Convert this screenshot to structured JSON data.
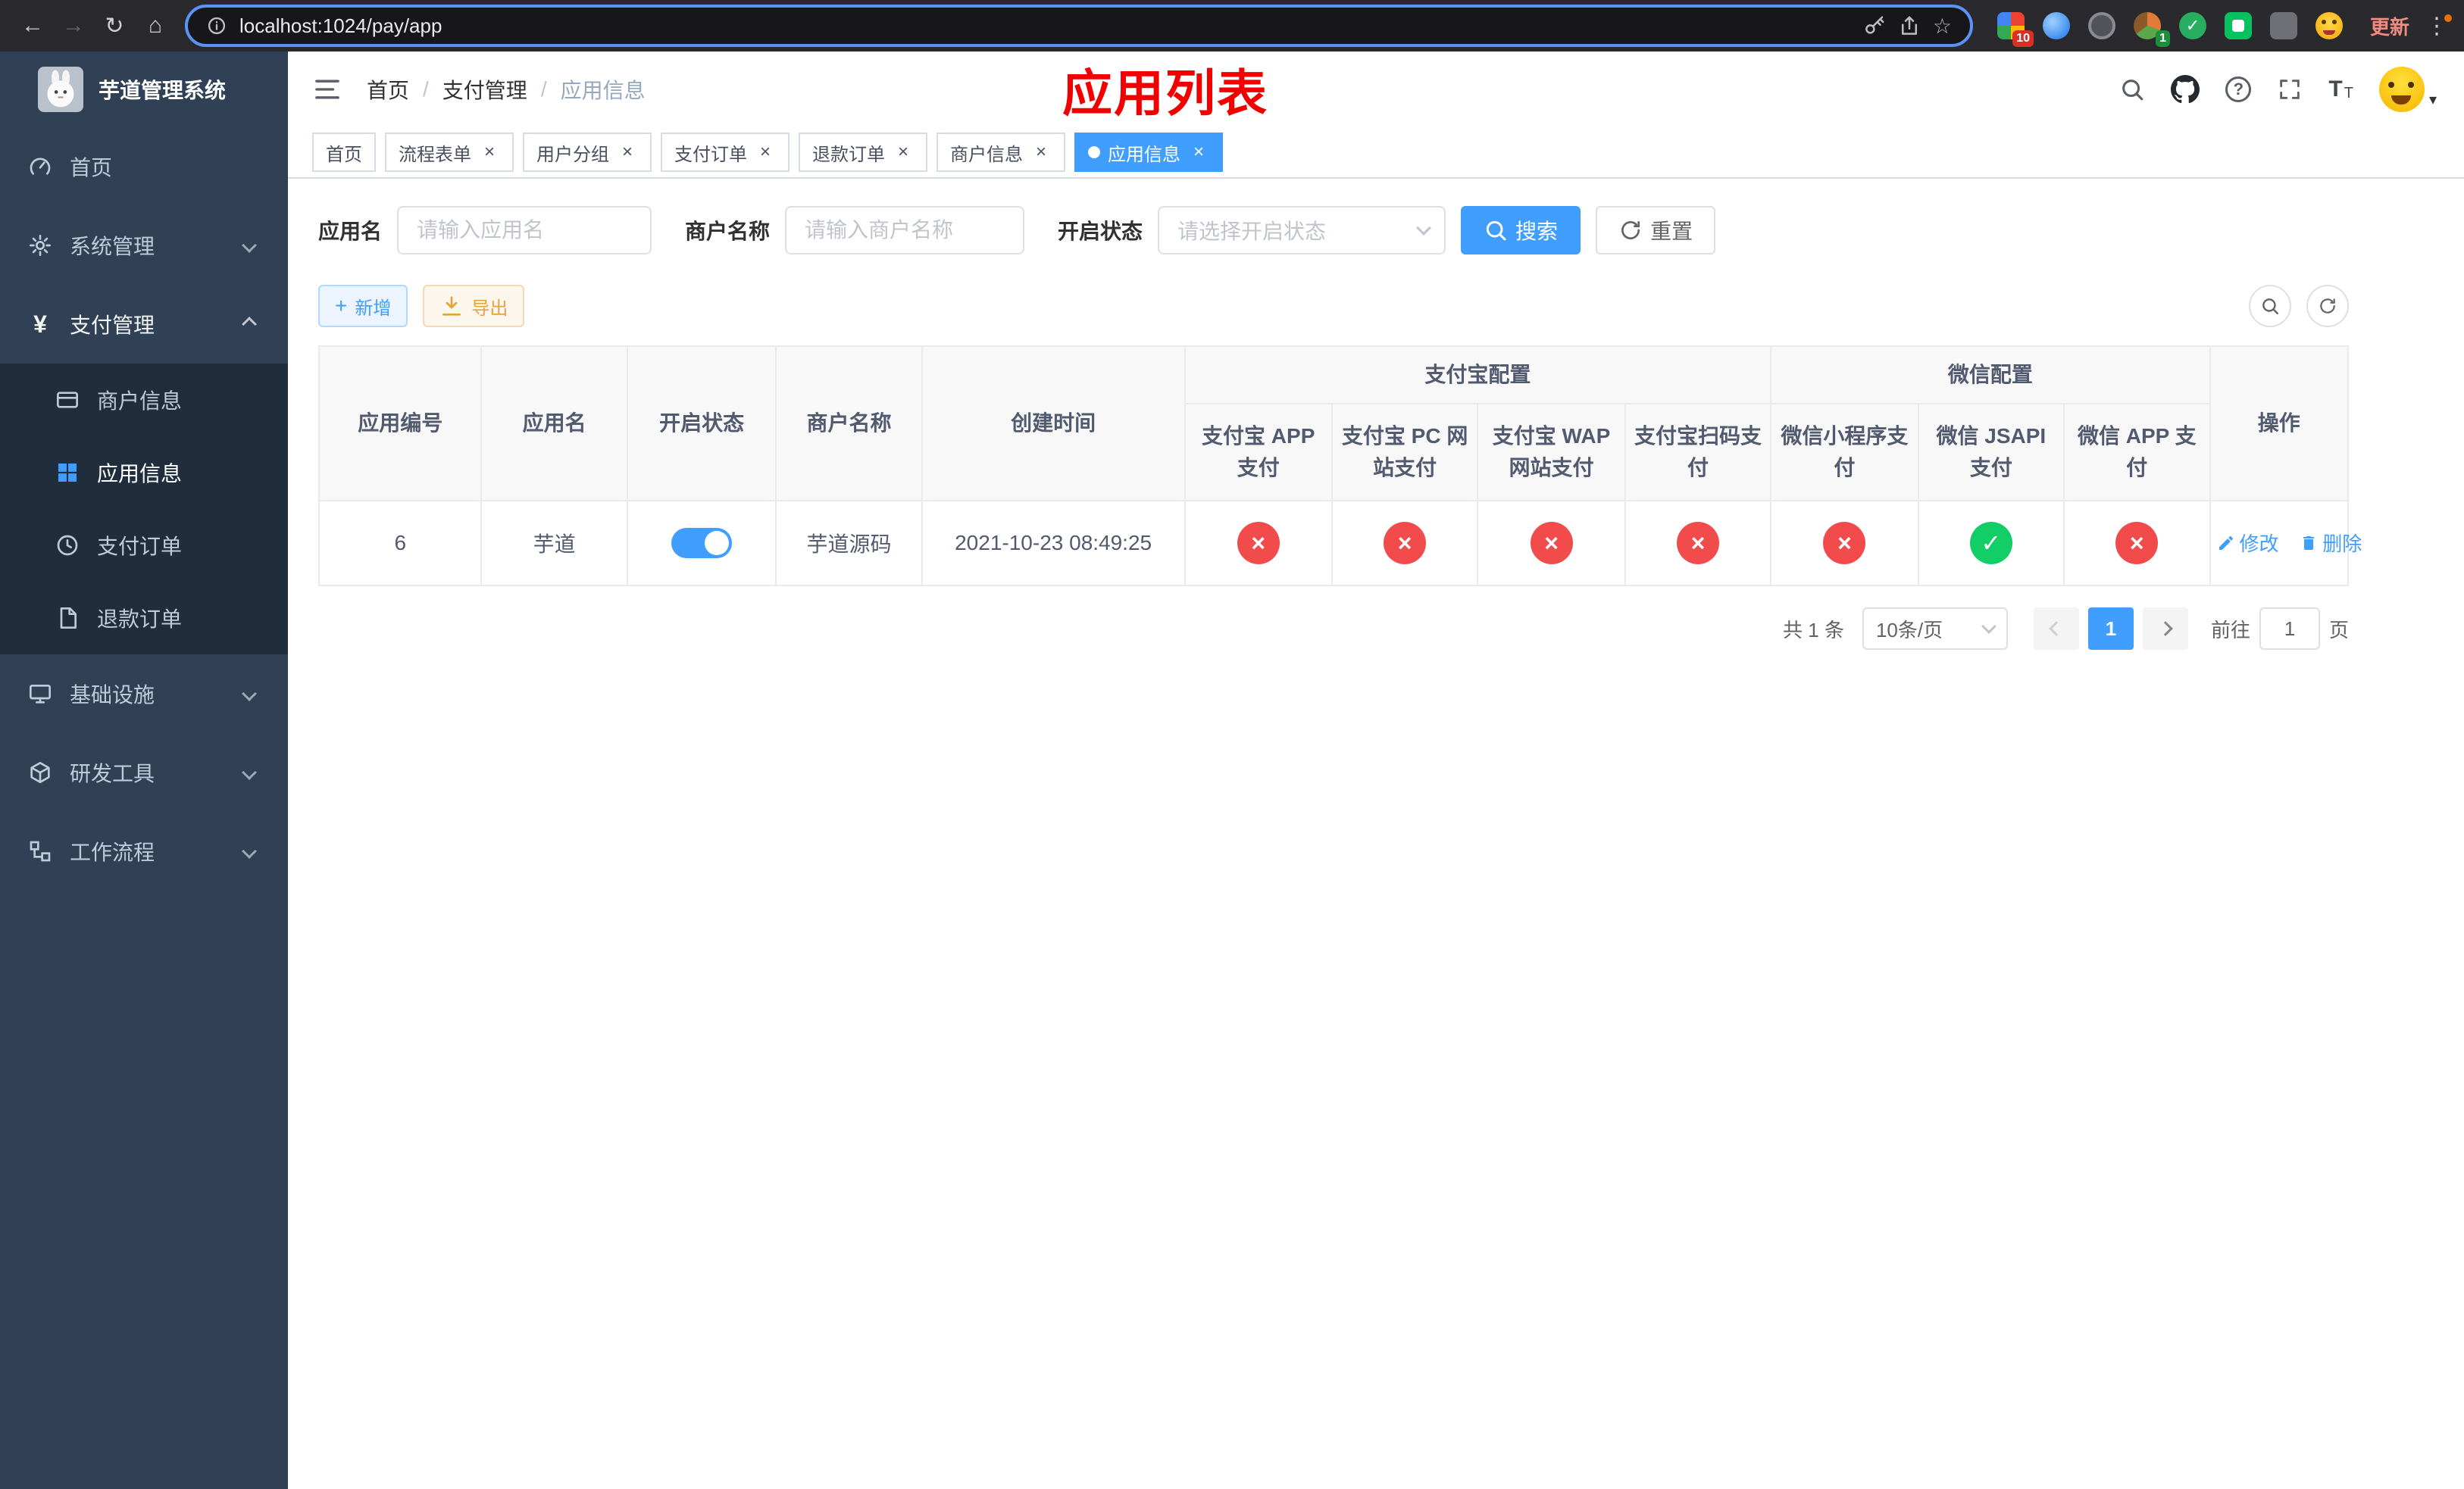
{
  "colors": {
    "primary": "#409EFF",
    "danger": "#f24b4b",
    "success": "#13ce66",
    "warning": "#e6a23c",
    "annotation": "#f20000"
  },
  "icons": {
    "back": "←",
    "forward": "→",
    "reload": "↻",
    "home": "⌂",
    "star": "☆",
    "kebab": "⋮",
    "caret_down": "▾",
    "check": "✓",
    "cross": "×",
    "plus": "+",
    "yen": "¥",
    "question": "?",
    "text_size": "T"
  },
  "browser": {
    "url": "localhost:1024/pay/app",
    "update_label": "更新",
    "ext_badge_red": "10",
    "ext_badge_green": "1"
  },
  "sidebar": {
    "title": "芋道管理系统",
    "items": [
      {
        "label": "首页"
      },
      {
        "label": "系统管理"
      },
      {
        "label": "支付管理"
      },
      {
        "label": "基础设施"
      },
      {
        "label": "研发工具"
      },
      {
        "label": "工作流程"
      }
    ],
    "submenu": [
      {
        "label": "商户信息"
      },
      {
        "label": "应用信息"
      },
      {
        "label": "支付订单"
      },
      {
        "label": "退款订单"
      }
    ]
  },
  "header": {
    "breadcrumb": [
      "首页",
      "支付管理",
      "应用信息"
    ],
    "separator": "/",
    "annotation": "应用列表"
  },
  "tabs": [
    {
      "label": "首页"
    },
    {
      "label": "流程表单"
    },
    {
      "label": "用户分组"
    },
    {
      "label": "支付订单"
    },
    {
      "label": "退款订单"
    },
    {
      "label": "商户信息"
    },
    {
      "label": "应用信息"
    }
  ],
  "filters": {
    "app_name_label": "应用名",
    "app_name_placeholder": "请输入应用名",
    "merchant_label": "商户名称",
    "merchant_placeholder": "请输入商户名称",
    "status_label": "开启状态",
    "status_placeholder": "请选择开启状态",
    "search_label": "搜索",
    "reset_label": "重置"
  },
  "toolbar": {
    "add_label": "新增",
    "export_label": "导出"
  },
  "table": {
    "main_columns": [
      "应用编号",
      "应用名",
      "开启状态",
      "商户名称",
      "创建时间"
    ],
    "group_alipay": "支付宝配置",
    "group_wechat": "微信配置",
    "sub_columns": [
      "支付宝 APP 支付",
      "支付宝 PC 网站支付",
      "支付宝 WAP 网站支付",
      "支付宝扫码支付",
      "微信小程序支付",
      "微信 JSAPI 支付",
      "微信 APP 支付"
    ],
    "op_column": "操作",
    "row": {
      "id": "6",
      "name": "芋道",
      "status": true,
      "merchant": "芋道源码",
      "created": "2021-10-23 08:49:25",
      "configs": [
        "no",
        "no",
        "no",
        "no",
        "no",
        "yes",
        "no"
      ],
      "edit_label": "修改",
      "delete_label": "删除"
    }
  },
  "pagination": {
    "total": "共 1 条",
    "page_size": "10条/页",
    "current": "1",
    "goto_prefix": "前往",
    "goto_value": "1",
    "goto_suffix": "页"
  }
}
